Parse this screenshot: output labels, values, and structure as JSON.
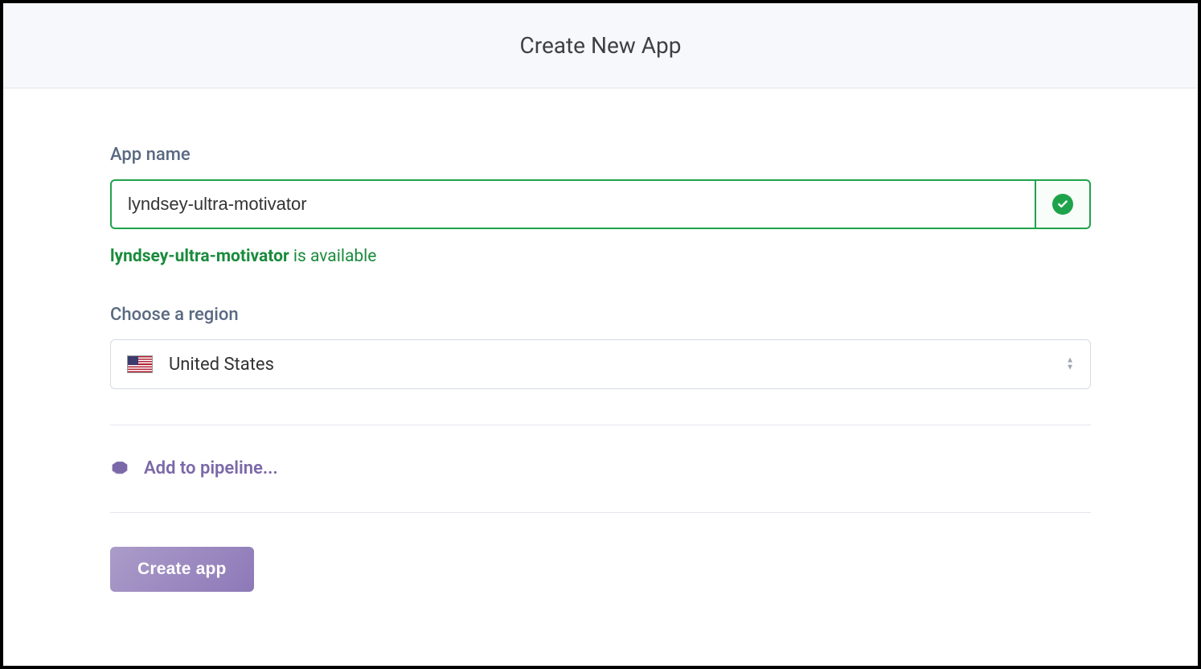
{
  "header": {
    "title": "Create New App"
  },
  "form": {
    "app_name_label": "App name",
    "app_name_value": "lyndsey-ultra-motivator",
    "availability_name": "lyndsey-ultra-motivator",
    "availability_suffix": " is available",
    "region_label": "Choose a region",
    "region_selected": "United States",
    "pipeline_label": "Add to pipeline...",
    "create_button": "Create app"
  }
}
